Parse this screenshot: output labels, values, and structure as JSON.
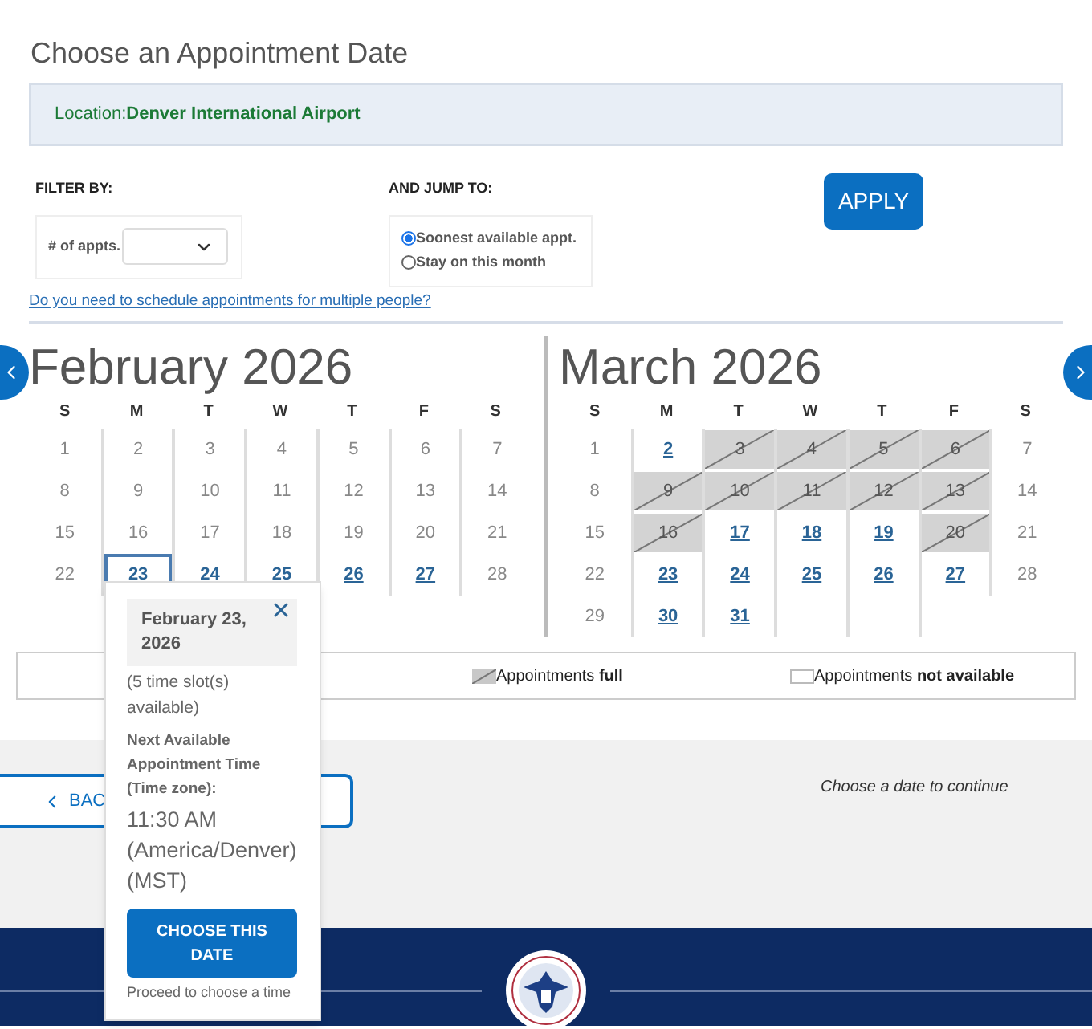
{
  "page_title": "Choose an Appointment Date",
  "location": "Location:**Denver International Airport**",
  "filter": {
    "heading": "FILTER BY:",
    "field_label": "# of appts."
  },
  "jump": {
    "heading": "AND JUMP TO:",
    "options": [
      {
        "label": "Soonest available appt.",
        "selected": true
      },
      {
        "label": "Stay on this month",
        "selected": false
      }
    ]
  },
  "apply_button": "APPLY",
  "multiple_link": "Do you need to schedule appointments for multiple people?",
  "months": [
    {
      "title": "February 2026",
      "weekdays": [
        "S",
        "M",
        "T",
        "W",
        "T",
        "F",
        "S"
      ],
      "weeks": [
        {
          "days": [
            {
              "label": "1",
              "kind": "unavailable",
              "selected": false
            },
            {
              "label": "2",
              "kind": "unavailable",
              "selected": false
            },
            {
              "label": "3",
              "kind": "unavailable",
              "selected": false
            },
            {
              "label": "4",
              "kind": "unavailable",
              "selected": false
            },
            {
              "label": "5",
              "kind": "unavailable",
              "selected": false
            },
            {
              "label": "6",
              "kind": "unavailable",
              "selected": false
            },
            {
              "label": "7",
              "kind": "unavailable",
              "selected": false
            }
          ]
        },
        {
          "days": [
            {
              "label": "8",
              "kind": "unavailable",
              "selected": false
            },
            {
              "label": "9",
              "kind": "unavailable",
              "selected": false
            },
            {
              "label": "10",
              "kind": "unavailable",
              "selected": false
            },
            {
              "label": "11",
              "kind": "unavailable",
              "selected": false
            },
            {
              "label": "12",
              "kind": "unavailable",
              "selected": false
            },
            {
              "label": "13",
              "kind": "unavailable",
              "selected": false
            },
            {
              "label": "14",
              "kind": "unavailable",
              "selected": false
            }
          ]
        },
        {
          "days": [
            {
              "label": "15",
              "kind": "unavailable",
              "selected": false
            },
            {
              "label": "16",
              "kind": "unavailable",
              "selected": false
            },
            {
              "label": "17",
              "kind": "unavailable",
              "selected": false
            },
            {
              "label": "18",
              "kind": "unavailable",
              "selected": false
            },
            {
              "label": "19",
              "kind": "unavailable",
              "selected": false
            },
            {
              "label": "20",
              "kind": "unavailable",
              "selected": false
            },
            {
              "label": "21",
              "kind": "unavailable",
              "selected": false
            }
          ]
        },
        {
          "days": [
            {
              "label": "22",
              "kind": "unavailable",
              "selected": false
            },
            {
              "label": "23",
              "kind": "available",
              "selected": true
            },
            {
              "label": "24",
              "kind": "available",
              "selected": false
            },
            {
              "label": "25",
              "kind": "available",
              "selected": false
            },
            {
              "label": "26",
              "kind": "available",
              "selected": false
            },
            {
              "label": "27",
              "kind": "available",
              "selected": false
            },
            {
              "label": "28",
              "kind": "unavailable",
              "selected": false
            }
          ]
        }
      ]
    },
    {
      "title": "March 2026",
      "weekdays": [
        "S",
        "M",
        "T",
        "W",
        "T",
        "F",
        "S"
      ],
      "weeks": [
        {
          "days": [
            {
              "label": "1",
              "kind": "unavailable",
              "selected": false
            },
            {
              "label": "2",
              "kind": "available",
              "selected": false
            },
            {
              "label": "3",
              "kind": "full",
              "selected": false
            },
            {
              "label": "4",
              "kind": "full",
              "selected": false
            },
            {
              "label": "5",
              "kind": "full",
              "selected": false
            },
            {
              "label": "6",
              "kind": "full",
              "selected": false
            },
            {
              "label": "7",
              "kind": "unavailable",
              "selected": false
            }
          ]
        },
        {
          "days": [
            {
              "label": "8",
              "kind": "unavailable",
              "selected": false
            },
            {
              "label": "9",
              "kind": "full",
              "selected": false
            },
            {
              "label": "10",
              "kind": "full",
              "selected": false
            },
            {
              "label": "11",
              "kind": "full",
              "selected": false
            },
            {
              "label": "12",
              "kind": "full",
              "selected": false
            },
            {
              "label": "13",
              "kind": "full",
              "selected": false
            },
            {
              "label": "14",
              "kind": "unavailable",
              "selected": false
            }
          ]
        },
        {
          "days": [
            {
              "label": "15",
              "kind": "unavailable",
              "selected": false
            },
            {
              "label": "16",
              "kind": "full",
              "selected": false
            },
            {
              "label": "17",
              "kind": "available",
              "selected": false
            },
            {
              "label": "18",
              "kind": "available",
              "selected": false
            },
            {
              "label": "19",
              "kind": "available",
              "selected": false
            },
            {
              "label": "20",
              "kind": "full",
              "selected": false
            },
            {
              "label": "21",
              "kind": "unavailable",
              "selected": false
            }
          ]
        },
        {
          "days": [
            {
              "label": "22",
              "kind": "unavailable",
              "selected": false
            },
            {
              "label": "23",
              "kind": "available",
              "selected": false
            },
            {
              "label": "24",
              "kind": "available",
              "selected": false
            },
            {
              "label": "25",
              "kind": "available",
              "selected": false
            },
            {
              "label": "26",
              "kind": "available",
              "selected": false
            },
            {
              "label": "27",
              "kind": "available",
              "selected": false
            },
            {
              "label": "28",
              "kind": "unavailable",
              "selected": false
            }
          ]
        },
        {
          "days": [
            {
              "label": "29",
              "kind": "unavailable",
              "selected": false
            },
            {
              "label": "30",
              "kind": "available",
              "selected": false
            },
            {
              "label": "31",
              "kind": "available",
              "selected": false
            }
          ]
        }
      ]
    }
  ],
  "legend": [
    {
      "kind": "full",
      "text": "Appointments **full**"
    },
    {
      "kind": "unavailable",
      "text": "Appointments **not available**"
    }
  ],
  "back_button": "BAC",
  "continue_hint": "Choose a date to continue",
  "popover": {
    "date": "February 23, 2026",
    "slots": "(5 time slot(s) available)",
    "next_label": "Next Available Appointment Time (Time zone):",
    "time": "11:30 AM (America/Denver) (MST)",
    "button": "CHOOSE THIS DATE",
    "note": "Proceed to choose a time"
  }
}
